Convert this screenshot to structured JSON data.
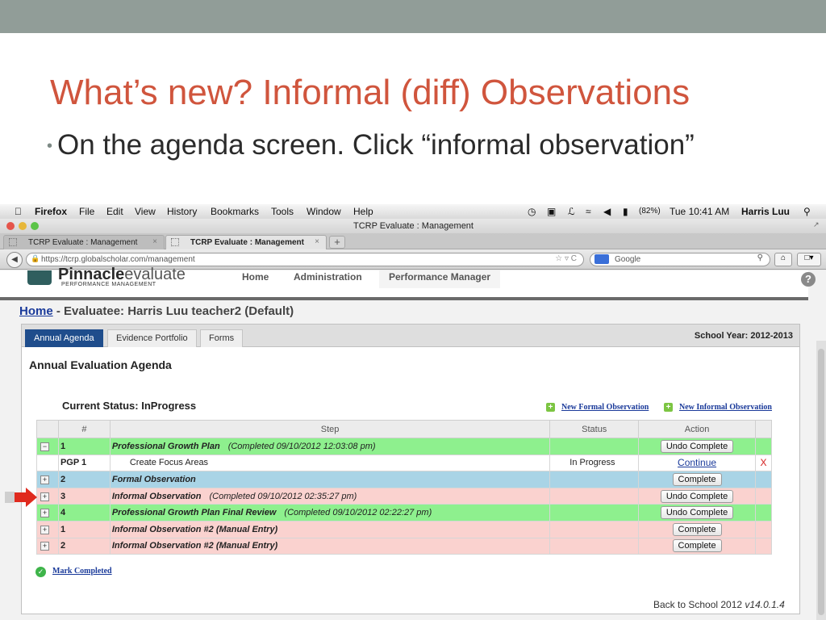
{
  "slide": {
    "title": "What’s new? Informal (diff) Observations",
    "bullet": "On the agenda screen. Click “informal observation”"
  },
  "menubar": {
    "app": "Firefox",
    "items": [
      "File",
      "Edit",
      "View",
      "History",
      "Bookmarks",
      "Tools",
      "Window",
      "Help"
    ],
    "battery": "(82%)",
    "clock": "Tue 10:41 AM",
    "user": "Harris Luu"
  },
  "window": {
    "title": "TCRP Evaluate : Management",
    "tabs": [
      {
        "label": "TCRP Evaluate : Management"
      },
      {
        "label": "TCRP Evaluate : Management"
      }
    ],
    "url": "https://tcrp.globalscholar.com/management",
    "search_placeholder": "Google"
  },
  "app": {
    "logo_main": "Pinnacle",
    "logo_light": "evaluate",
    "logo_sub": "PERFORMANCE MANAGEMENT",
    "nav": [
      "Home",
      "Administration",
      "Performance Manager"
    ],
    "help": "?",
    "breadcrumb_home": "Home",
    "breadcrumb_rest": " - Evaluatee: Harris Luu teacher2 (Default)"
  },
  "panel": {
    "tabs": [
      "Annual Agenda",
      "Evidence Portfolio",
      "Forms"
    ],
    "school_year": "School Year: 2012-2013",
    "heading": "Annual Evaluation Agenda",
    "status": "Current Status: InProgress",
    "new_formal": "New Formal Observation",
    "new_informal": "New Informal Observation"
  },
  "table": {
    "headers": [
      "#",
      "Step",
      "Status",
      "Action"
    ],
    "rows": [
      {
        "expander": "−",
        "num": "1",
        "step": "Professional Growth Plan",
        "note": "(Completed 09/10/2012 12:03:08 pm)",
        "status": "",
        "action": "Undo Complete",
        "x": ""
      },
      {
        "expander": "",
        "num": "PGP 1",
        "step": "Create Focus Areas",
        "note": "",
        "status": "In Progress",
        "action": "Continue",
        "x": "X"
      },
      {
        "expander": "+",
        "num": "2",
        "step": "Formal Observation",
        "note": "",
        "status": "",
        "action": "Complete",
        "x": ""
      },
      {
        "expander": "+",
        "num": "3",
        "step": "Informal Observation",
        "note": "(Completed 09/10/2012 02:35:27 pm)",
        "status": "",
        "action": "Undo Complete",
        "x": ""
      },
      {
        "expander": "+",
        "num": "4",
        "step": "Professional Growth Plan Final Review",
        "note": "(Completed 09/10/2012 02:22:27 pm)",
        "status": "",
        "action": "Undo Complete",
        "x": ""
      },
      {
        "expander": "+",
        "num": "1",
        "step": "Informal Observation #2 (Manual Entry)",
        "note": "",
        "status": "",
        "action": "Complete",
        "x": ""
      },
      {
        "expander": "+",
        "num": "2",
        "step": "Informal Observation #2 (Manual Entry)",
        "note": "",
        "status": "",
        "action": "Complete",
        "x": ""
      }
    ]
  },
  "mark_completed": "Mark Completed",
  "footer": {
    "text": "Back to School 2012 ",
    "version": "v14.0.1.4"
  }
}
